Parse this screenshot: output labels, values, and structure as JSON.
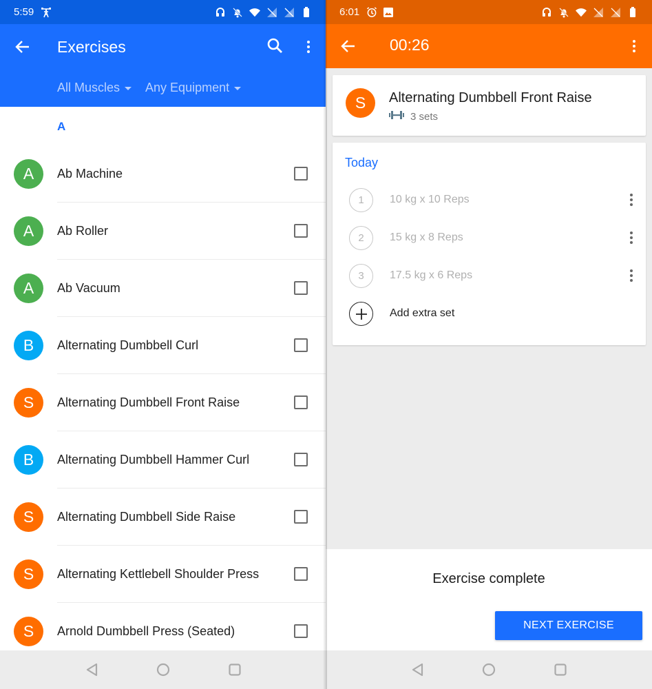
{
  "colors": {
    "primary_blue": "#1a6eff",
    "blue_status": "#0a5fe0",
    "orange": "#ff6d00",
    "orange_status": "#e06000",
    "green_avatar": "#4caf50",
    "blue_avatar": "#03a9f4"
  },
  "left_screen": {
    "status_bar": {
      "time": "5:59",
      "left_icons": [
        "weightlifter-icon"
      ],
      "right_icons": [
        "headset-icon",
        "bell-off-icon",
        "wifi-icon",
        "no-signal-icon",
        "no-signal-icon",
        "battery-icon"
      ]
    },
    "app_bar": {
      "title": "Exercises",
      "back_icon": "arrow-back-icon",
      "search_icon": "search-icon",
      "overflow_icon": "more-vert-icon"
    },
    "filters": [
      {
        "label": "All Muscles"
      },
      {
        "label": "Any Equipment"
      }
    ],
    "section_letter": "A",
    "exercises": [
      {
        "initial": "A",
        "name": "Ab Machine",
        "color": "#4caf50",
        "checked": false
      },
      {
        "initial": "A",
        "name": "Ab Roller",
        "color": "#4caf50",
        "checked": false
      },
      {
        "initial": "A",
        "name": "Ab Vacuum",
        "color": "#4caf50",
        "checked": false
      },
      {
        "initial": "B",
        "name": "Alternating Dumbbell Curl",
        "color": "#03a9f4",
        "checked": false
      },
      {
        "initial": "S",
        "name": "Alternating Dumbbell Front Raise",
        "color": "#ff6d00",
        "checked": false
      },
      {
        "initial": "B",
        "name": "Alternating Dumbbell Hammer Curl",
        "color": "#03a9f4",
        "checked": false
      },
      {
        "initial": "S",
        "name": "Alternating Dumbbell Side Raise",
        "color": "#ff6d00",
        "checked": false
      },
      {
        "initial": "S",
        "name": "Alternating Kettlebell Shoulder Press",
        "color": "#ff6d00",
        "checked": false
      },
      {
        "initial": "S",
        "name": "Arnold Dumbbell Press (Seated)",
        "color": "#ff6d00",
        "checked": false
      }
    ]
  },
  "right_screen": {
    "status_bar": {
      "time": "6:01",
      "left_icons": [
        "alarm-icon",
        "image-icon"
      ],
      "right_icons": [
        "headset-icon",
        "bell-off-icon",
        "wifi-icon",
        "no-signal-icon",
        "no-signal-icon",
        "battery-icon"
      ]
    },
    "app_bar": {
      "timer": "00:26",
      "back_icon": "arrow-back-icon",
      "overflow_icon": "more-vert-icon"
    },
    "exercise": {
      "initial": "S",
      "name": "Alternating Dumbbell Front Raise",
      "sets_label": "3 sets",
      "equipment_icon": "dumbbell-icon"
    },
    "log": {
      "heading": "Today",
      "sets": [
        {
          "number": "1",
          "text": "10 kg x 10 Reps"
        },
        {
          "number": "2",
          "text": "15 kg x 8 Reps"
        },
        {
          "number": "3",
          "text": "17.5 kg x 6 Reps"
        }
      ],
      "add_label": "Add extra set"
    },
    "footer": {
      "status": "Exercise complete",
      "next_button": "NEXT EXERCISE"
    }
  },
  "nav_bar": {
    "back": "nav-back-icon",
    "home": "nav-home-icon",
    "recents": "nav-recents-icon"
  }
}
